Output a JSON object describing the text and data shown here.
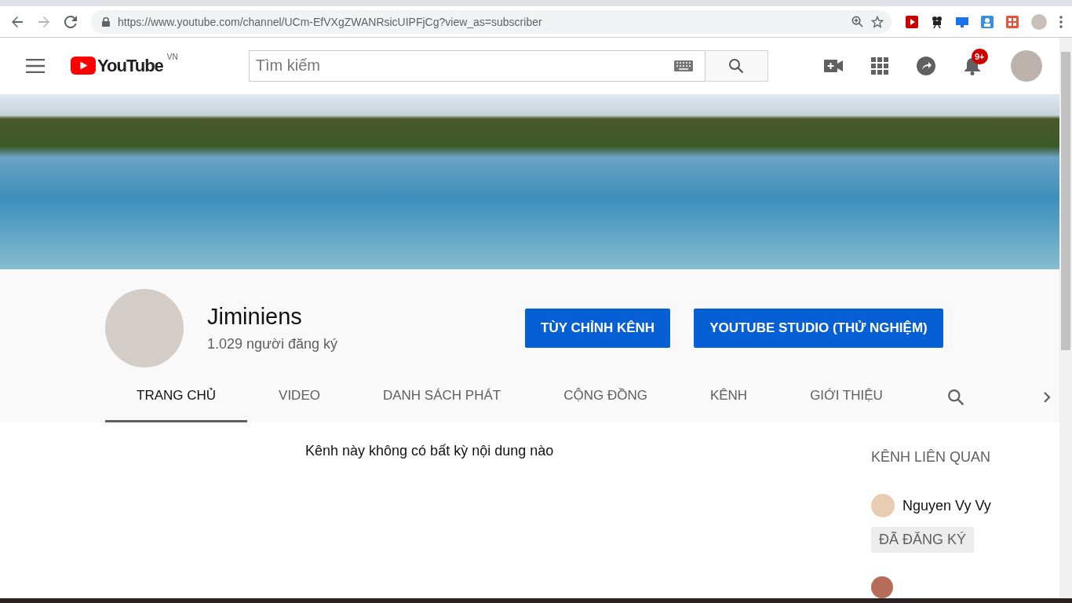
{
  "browser": {
    "url": "https://www.youtube.com/channel/UCm-EfVXgZWANRsicUIPFjCg?view_as=subscriber"
  },
  "header": {
    "logo_text": "YouTube",
    "logo_region": "VN",
    "search": {
      "placeholder": "Tìm kiếm"
    },
    "notification_count": "9+"
  },
  "channel": {
    "name": "Jiminiens",
    "subscribers": "1.029 người đăng ký",
    "buttons": [
      "TÙY CHỈNH KÊNH",
      "YOUTUBE STUDIO (THỬ NGHIỆM)"
    ],
    "tabs": [
      {
        "label": "TRANG CHỦ",
        "selected": true
      },
      {
        "label": "VIDEO",
        "selected": false
      },
      {
        "label": "DANH SÁCH PHÁT",
        "selected": false
      },
      {
        "label": "CỘNG ĐỒNG",
        "selected": false
      },
      {
        "label": "KÊNH",
        "selected": false
      },
      {
        "label": "GIỚI THIỆU",
        "selected": false
      }
    ]
  },
  "content": {
    "empty_message": "Kênh này không có bất kỳ nội dung nào"
  },
  "related": {
    "title": "KÊNH LIÊN QUAN",
    "channels": [
      {
        "name": "Nguyen Vy Vy",
        "subscribe_label": "ĐÃ ĐĂNG KÝ"
      }
    ]
  }
}
